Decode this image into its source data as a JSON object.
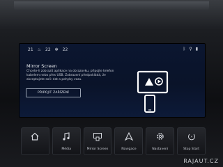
{
  "status": {
    "temp_left": "21",
    "seat_left": "22",
    "seat_right": "22",
    "icons": [
      "bluetooth-icon",
      "usb-icon",
      "signal-icon"
    ]
  },
  "mirror": {
    "title": "Mirror Screen",
    "description": "Chcete-li zobrazit aplikace na obrazovku, připojte telefon kabelem nebo přes USB. Zobrazení předpokládá, že akceptujete soli: dat a pohyby vozu.",
    "button": "PŘIPOJIT ZAŘÍZENÍ"
  },
  "touchbar": {
    "items": [
      {
        "label": "",
        "icon": "home-icon"
      },
      {
        "label": "Média",
        "icon": "music-icon"
      },
      {
        "label": "Mirror Screen",
        "icon": "mirror-screen-icon"
      },
      {
        "label": "Navigace",
        "icon": "navigation-icon"
      },
      {
        "label": "Nastavení",
        "icon": "settings-icon"
      },
      {
        "label": "Stop Start",
        "icon": "stop-start-icon"
      }
    ]
  },
  "watermark": "RAJAUT.CZ",
  "colors": {
    "screen_bg": "#0b1630",
    "accent": "#ffffff"
  }
}
